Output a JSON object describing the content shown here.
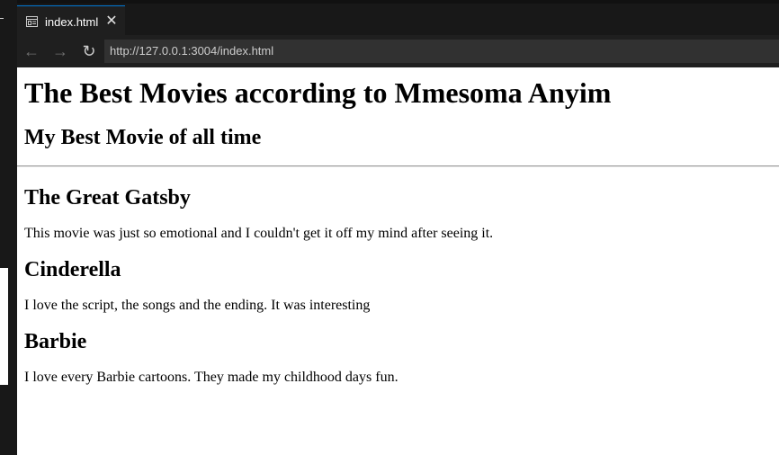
{
  "tab": {
    "title": "index.html",
    "close_glyph": "✕"
  },
  "nav": {
    "back_glyph": "←",
    "forward_glyph": "→",
    "refresh_glyph": "↻",
    "url": "http://127.0.0.1:3004/index.html"
  },
  "page": {
    "heading": "The Best Movies according to Mmesoma Anyim",
    "subheading": "My Best Movie of all time",
    "movies": [
      {
        "title": "The Great Gatsby",
        "description": "This movie was just so emotional and I couldn't get it off my mind after seeing it."
      },
      {
        "title": "Cinderella",
        "description": "I love the script, the songs and the ending. It was interesting"
      },
      {
        "title": "Barbie",
        "description": "I love every Barbie cartoons. They made my childhood days fun."
      }
    ]
  },
  "colors": {
    "accent": "#0078d4",
    "chrome_bg": "#1f1f1f",
    "url_bg": "#313131"
  }
}
